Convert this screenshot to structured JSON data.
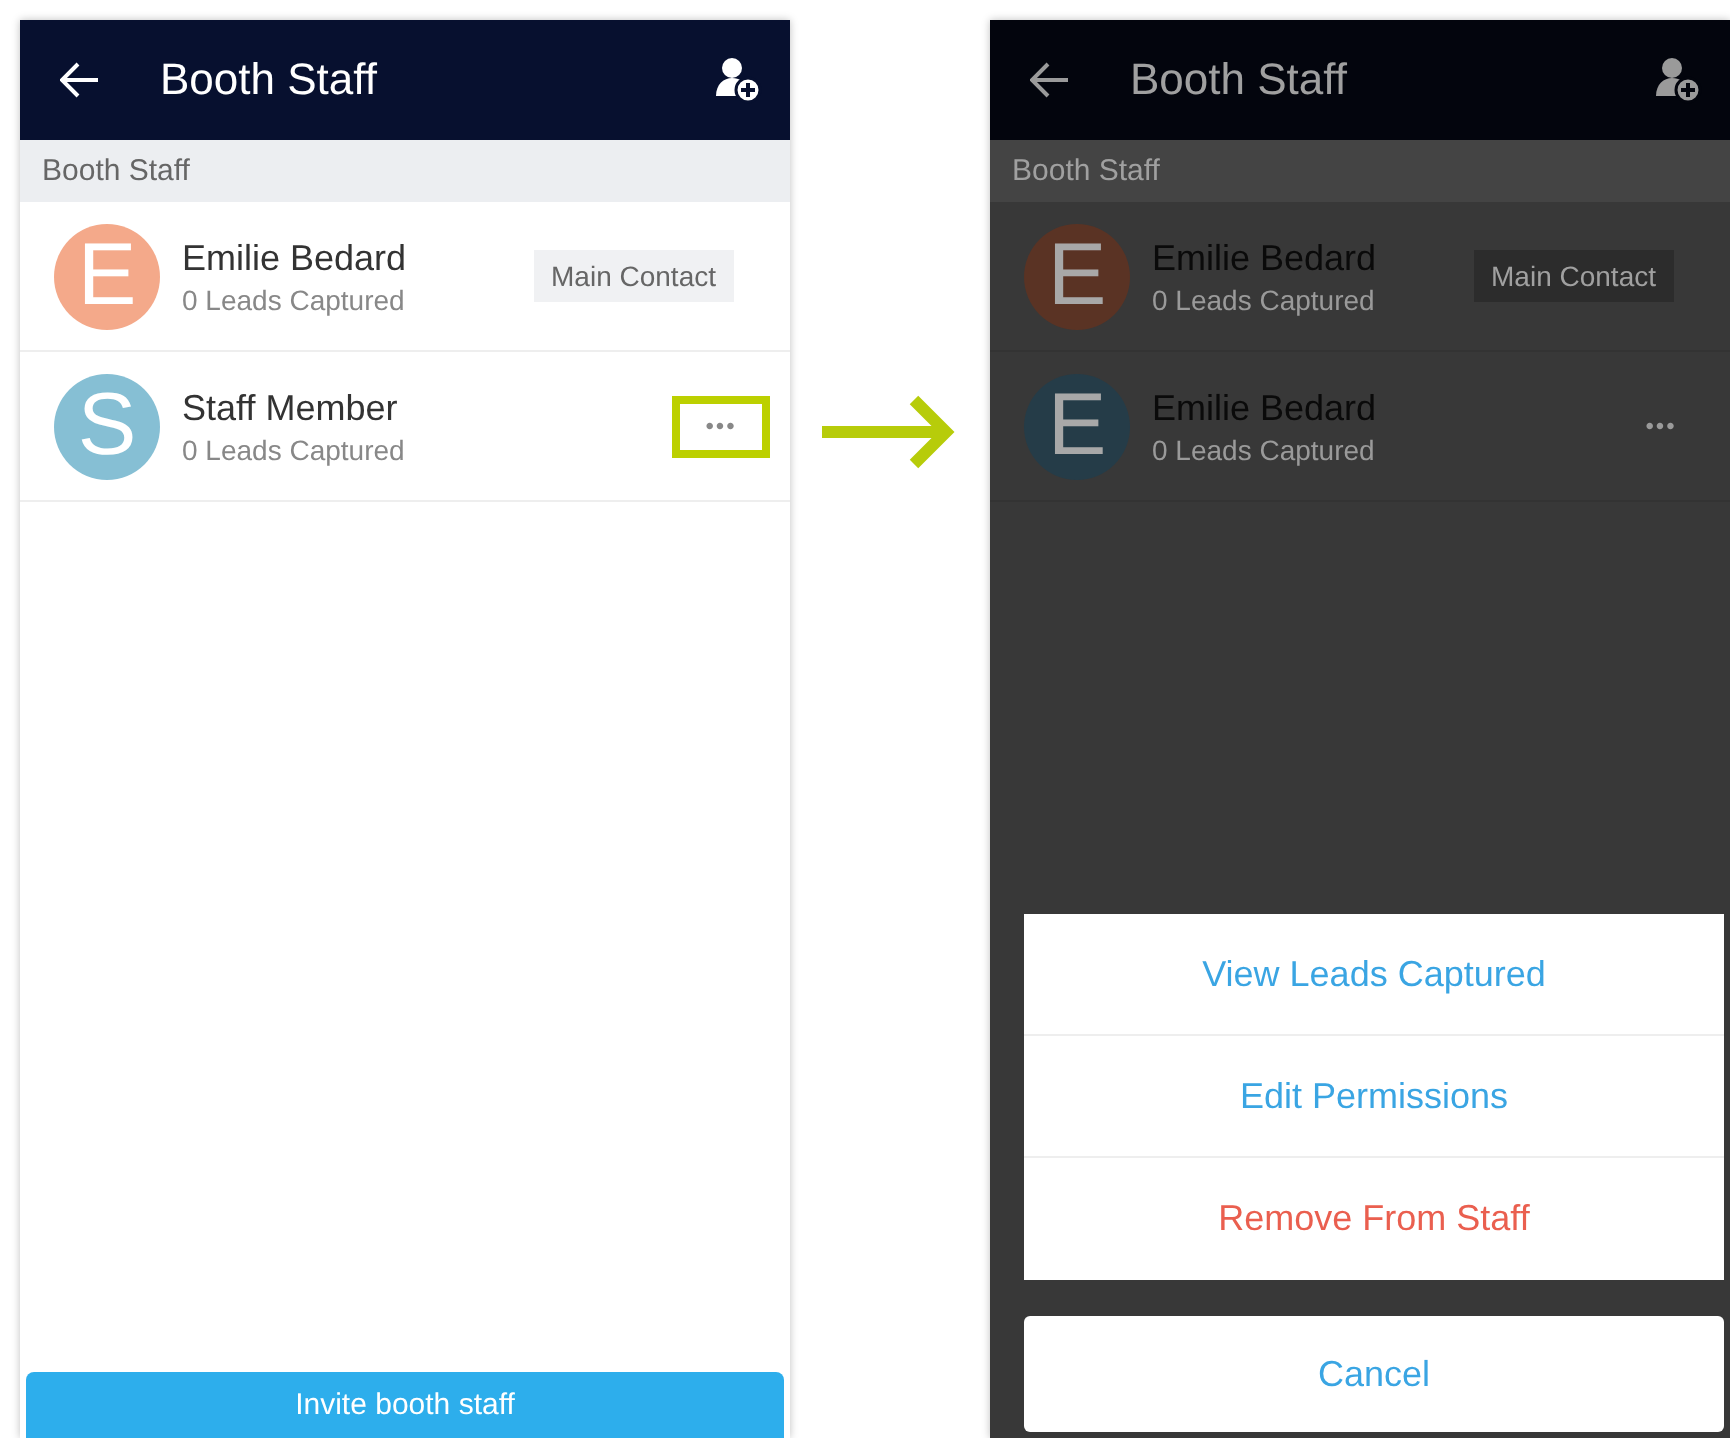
{
  "screens": [
    {
      "dimmed": false,
      "header": {
        "title": "Booth Staff"
      },
      "section": "Booth Staff",
      "staff": [
        {
          "initial": "E",
          "name": "Emilie Bedard",
          "leads": "0 Leads Captured",
          "color": "#f4a98a",
          "kind": "badge",
          "badge": "Main Contact"
        },
        {
          "initial": "S",
          "name": "Staff Member",
          "leads": "0 Leads Captured",
          "color": "#86bfd4",
          "kind": "more",
          "more": "•••",
          "highlighted": true
        }
      ],
      "invite_button": "Invite booth staff"
    },
    {
      "dimmed": true,
      "header": {
        "title": "Booth Staff"
      },
      "section": "Booth Staff",
      "staff": [
        {
          "initial": "E",
          "name": "Emilie Bedard",
          "leads": "0 Leads Captured",
          "color": "#5a3324",
          "kind": "badge",
          "badge": "Main Contact"
        },
        {
          "initial": "E",
          "name": "Emilie Bedard",
          "leads": "0 Leads Captured",
          "color": "#253c48",
          "kind": "more",
          "more": "•••",
          "highlighted": false
        }
      ],
      "action_sheet": {
        "actions": [
          {
            "label": "View Leads Captured",
            "destructive": false
          },
          {
            "label": "Edit Permissions",
            "destructive": false
          },
          {
            "label": "Remove From Staff",
            "destructive": true
          }
        ],
        "cancel": "Cancel"
      }
    }
  ]
}
